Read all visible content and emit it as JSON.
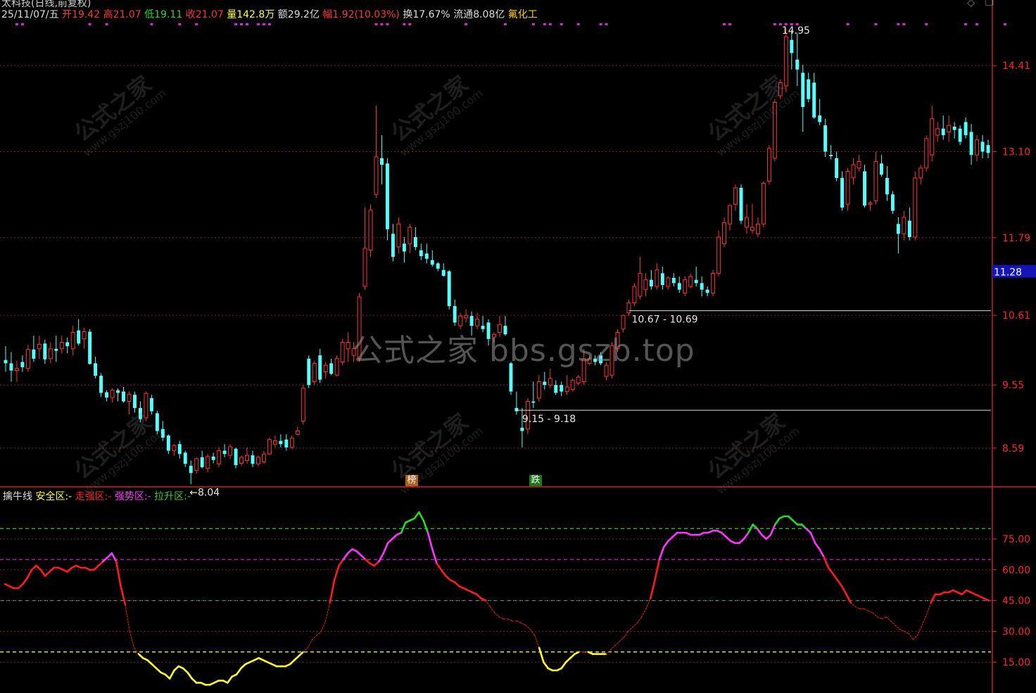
{
  "header": {
    "title": "太科技(日线,前复权)",
    "date": "25/11/07/五",
    "open_label": "开",
    "open": "19.42",
    "high_label": "高",
    "high": "21.07",
    "low_label": "低",
    "low": "19.11",
    "close_label": "收",
    "close": "21.07",
    "volume_label": "量",
    "volume": "142.8万",
    "amount_label": "额",
    "amount": "29.2亿",
    "change_label": "幅",
    "change": "1.92(10.03%)",
    "turnover_label": "换",
    "turnover": "17.67%",
    "float_label": "流通",
    "float": "8.08亿",
    "sector": "氟化工"
  },
  "indicator": {
    "name": "擒牛线",
    "items": [
      {
        "label": "安全区:",
        "value": "-",
        "color": "#ffff33"
      },
      {
        "label": "走强区:",
        "value": "-",
        "color": "#ff2222"
      },
      {
        "label": "强势区:",
        "value": "-",
        "color": "#ff33ff"
      },
      {
        "label": "拉升区:",
        "value": "-",
        "color": "#33cc33"
      }
    ]
  },
  "tags": [
    {
      "text": "榜",
      "bg": "#b06018"
    },
    {
      "text": "跌",
      "bg": "#1a7a1a"
    }
  ],
  "watermark": {
    "main": "公式之家 bbs.gszb.top",
    "brand": "公式之家",
    "url": "www.gszj100.com"
  },
  "colors": {
    "up": "#ff3333",
    "down": "#54ffff",
    "grid": "#8a1a1a",
    "axis": "#ff2222"
  },
  "chart_data": [
    {
      "type": "candlestick",
      "title": "太科技(日线,前复权)",
      "ylim": [
        8.0,
        15.3
      ],
      "y_ticks": [
        "14.41",
        "13.10",
        "11.79",
        "10.61",
        "9.55",
        "8.59"
      ],
      "current_price": "11.28",
      "annotations": [
        "←8.04",
        "14.95",
        "10.67 - 10.69",
        "9.15 - 9.18"
      ],
      "ohlc": [
        [
          9.93,
          10.14,
          9.75,
          9.88
        ],
        [
          9.88,
          10.05,
          9.6,
          9.77
        ],
        [
          9.77,
          9.92,
          9.6,
          9.8
        ],
        [
          9.9,
          10.0,
          9.75,
          9.82
        ],
        [
          9.8,
          10.16,
          9.75,
          10.09
        ],
        [
          10.09,
          10.3,
          9.9,
          9.95
        ],
        [
          10.1,
          10.3,
          9.95,
          10.17
        ],
        [
          10.18,
          10.24,
          9.87,
          9.94
        ],
        [
          9.95,
          10.2,
          9.88,
          10.1
        ],
        [
          10.1,
          10.3,
          9.9,
          10.07
        ],
        [
          10.1,
          10.3,
          10.03,
          10.2
        ],
        [
          10.2,
          10.27,
          10.03,
          10.14
        ],
        [
          10.1,
          10.45,
          10.0,
          10.35
        ],
        [
          10.38,
          10.55,
          10.15,
          10.18
        ],
        [
          10.25,
          10.42,
          10.1,
          10.36
        ],
        [
          10.36,
          10.4,
          9.86,
          9.87
        ],
        [
          9.88,
          9.98,
          9.65,
          9.69
        ],
        [
          9.69,
          9.73,
          9.37,
          9.43
        ],
        [
          9.44,
          9.47,
          9.3,
          9.36
        ],
        [
          9.36,
          9.5,
          9.28,
          9.47
        ],
        [
          9.47,
          9.5,
          9.3,
          9.43
        ],
        [
          9.45,
          9.52,
          9.28,
          9.3
        ],
        [
          9.3,
          9.45,
          9.1,
          9.41
        ],
        [
          9.4,
          9.45,
          9.13,
          9.2
        ],
        [
          9.2,
          9.3,
          8.98,
          9.03
        ],
        [
          9.05,
          9.45,
          9.0,
          9.42
        ],
        [
          9.35,
          9.4,
          9.1,
          9.15
        ],
        [
          9.12,
          9.16,
          8.8,
          8.85
        ],
        [
          8.88,
          9.0,
          8.7,
          8.75
        ],
        [
          8.78,
          8.8,
          8.5,
          8.55
        ],
        [
          8.55,
          8.65,
          8.47,
          8.63
        ],
        [
          8.65,
          8.7,
          8.43,
          8.5
        ],
        [
          8.52,
          8.55,
          8.3,
          8.35
        ],
        [
          8.32,
          8.4,
          8.04,
          8.21
        ],
        [
          8.25,
          8.45,
          8.2,
          8.43
        ],
        [
          8.45,
          8.55,
          8.28,
          8.3
        ],
        [
          8.28,
          8.5,
          8.22,
          8.46
        ],
        [
          8.46,
          8.52,
          8.36,
          8.41
        ],
        [
          8.35,
          8.6,
          8.3,
          8.55
        ],
        [
          8.55,
          8.65,
          8.45,
          8.5
        ],
        [
          8.48,
          8.65,
          8.42,
          8.61
        ],
        [
          8.58,
          8.6,
          8.28,
          8.33
        ],
        [
          8.36,
          8.48,
          8.32,
          8.45
        ],
        [
          8.4,
          8.6,
          8.35,
          8.48
        ],
        [
          8.48,
          8.55,
          8.3,
          8.35
        ],
        [
          8.35,
          8.48,
          8.31,
          8.45
        ],
        [
          8.38,
          8.55,
          8.35,
          8.5
        ],
        [
          8.5,
          8.75,
          8.48,
          8.72
        ],
        [
          8.65,
          8.78,
          8.6,
          8.7
        ],
        [
          8.7,
          8.8,
          8.6,
          8.65
        ],
        [
          8.72,
          8.8,
          8.55,
          8.6
        ],
        [
          8.6,
          8.78,
          8.58,
          8.74
        ],
        [
          8.8,
          8.92,
          8.78,
          8.85
        ],
        [
          9.0,
          9.55,
          8.95,
          9.5
        ],
        [
          9.95,
          10.0,
          9.5,
          9.55
        ],
        [
          9.6,
          9.92,
          9.55,
          9.88
        ],
        [
          10.0,
          10.1,
          9.58,
          9.63
        ],
        [
          9.75,
          9.9,
          9.65,
          9.85
        ],
        [
          9.88,
          9.95,
          9.7,
          9.72
        ],
        [
          9.7,
          10.0,
          9.68,
          9.95
        ],
        [
          9.9,
          10.25,
          9.85,
          10.2
        ],
        [
          10.1,
          10.35,
          9.9,
          10.2
        ],
        [
          10.0,
          10.2,
          9.9,
          10.1
        ],
        [
          9.95,
          10.95,
          9.9,
          10.89
        ],
        [
          11.05,
          12.25,
          11.0,
          11.63
        ],
        [
          11.6,
          12.3,
          11.5,
          12.21
        ],
        [
          12.45,
          13.8,
          12.4,
          13.02
        ],
        [
          13.0,
          13.35,
          12.6,
          12.9
        ],
        [
          12.92,
          13.0,
          11.75,
          11.92
        ],
        [
          11.85,
          12.0,
          11.43,
          11.5
        ],
        [
          11.65,
          12.1,
          11.55,
          12.0
        ],
        [
          11.7,
          11.8,
          11.41,
          11.58
        ],
        [
          11.7,
          12.0,
          11.55,
          11.95
        ],
        [
          11.8,
          11.95,
          11.6,
          11.65
        ],
        [
          11.6,
          11.7,
          11.45,
          11.51
        ],
        [
          11.55,
          11.7,
          11.4,
          11.47
        ],
        [
          11.45,
          11.6,
          11.35,
          11.38
        ],
        [
          11.4,
          11.42,
          11.28,
          11.32
        ],
        [
          11.3,
          11.4,
          11.2,
          11.21
        ],
        [
          11.28,
          11.3,
          10.7,
          10.75
        ],
        [
          10.75,
          10.85,
          10.45,
          10.5
        ],
        [
          10.45,
          10.65,
          10.4,
          10.6
        ],
        [
          10.57,
          10.7,
          10.5,
          10.61
        ],
        [
          10.6,
          10.67,
          10.3,
          10.45
        ],
        [
          10.45,
          10.65,
          10.4,
          10.55
        ],
        [
          10.45,
          10.6,
          10.35,
          10.4
        ],
        [
          10.5,
          10.55,
          10.15,
          10.25
        ],
        [
          10.28,
          10.35,
          10.2,
          10.32
        ],
        [
          10.35,
          10.6,
          10.28,
          10.47
        ],
        [
          10.45,
          10.6,
          10.3,
          10.32
        ],
        [
          9.88,
          9.9,
          9.4,
          9.45
        ],
        [
          9.2,
          9.45,
          9.1,
          9.15
        ],
        [
          8.9,
          9.2,
          8.6,
          8.85
        ],
        [
          8.88,
          9.35,
          8.8,
          9.3
        ],
        [
          9.3,
          9.6,
          9.2,
          9.28
        ],
        [
          9.35,
          9.7,
          9.3,
          9.6
        ],
        [
          9.6,
          9.75,
          9.48,
          9.55
        ],
        [
          9.55,
          9.8,
          9.5,
          9.65
        ],
        [
          9.55,
          9.62,
          9.4,
          9.43
        ],
        [
          9.55,
          9.6,
          9.38,
          9.45
        ],
        [
          9.45,
          9.7,
          9.4,
          9.52
        ],
        [
          9.48,
          9.65,
          9.45,
          9.62
        ],
        [
          9.58,
          9.7,
          9.55,
          9.67
        ],
        [
          9.6,
          10.1,
          9.55,
          9.95
        ],
        [
          9.88,
          10.0,
          9.85,
          9.95
        ],
        [
          9.95,
          10.0,
          9.85,
          9.9
        ],
        [
          10.0,
          10.05,
          9.85,
          9.88
        ],
        [
          9.68,
          9.9,
          9.62,
          9.85
        ],
        [
          9.7,
          10.2,
          9.65,
          10.15
        ],
        [
          10.1,
          10.4,
          10.05,
          10.35
        ],
        [
          10.4,
          10.62,
          10.35,
          10.61
        ],
        [
          10.65,
          10.85,
          10.6,
          10.8
        ],
        [
          10.8,
          11.1,
          10.75,
          11.05
        ],
        [
          10.9,
          11.5,
          10.85,
          11.25
        ],
        [
          11.0,
          11.25,
          10.9,
          11.15
        ],
        [
          11.15,
          11.3,
          11.0,
          11.05
        ],
        [
          11.05,
          11.4,
          11.0,
          11.3
        ],
        [
          11.25,
          11.35,
          11.0,
          11.07
        ],
        [
          11.05,
          11.2,
          11.0,
          11.18
        ],
        [
          11.18,
          11.25,
          11.05,
          11.1
        ],
        [
          11.1,
          11.2,
          10.95,
          11.0
        ],
        [
          10.95,
          11.2,
          10.9,
          11.15
        ],
        [
          11.05,
          11.25,
          11.02,
          11.2
        ],
        [
          11.15,
          11.35,
          11.05,
          11.1
        ],
        [
          11.1,
          11.2,
          10.9,
          11.0
        ],
        [
          11.0,
          11.05,
          10.9,
          10.95
        ],
        [
          10.95,
          11.3,
          10.9,
          11.25
        ],
        [
          11.25,
          11.9,
          11.2,
          11.8
        ],
        [
          11.7,
          12.1,
          11.65,
          12.02
        ],
        [
          12.0,
          12.3,
          11.9,
          12.28
        ],
        [
          12.3,
          12.6,
          12.2,
          12.55
        ],
        [
          12.55,
          12.6,
          12.0,
          12.05
        ],
        [
          11.95,
          12.3,
          11.85,
          12.1
        ],
        [
          11.9,
          12.3,
          11.85,
          11.95
        ],
        [
          11.85,
          12.1,
          11.8,
          12.0
        ],
        [
          12.0,
          12.65,
          11.95,
          12.62
        ],
        [
          12.65,
          13.2,
          12.6,
          13.15
        ],
        [
          13.0,
          13.9,
          12.95,
          13.85
        ],
        [
          13.95,
          14.2,
          13.9,
          14.15
        ],
        [
          14.1,
          14.98,
          14.0,
          14.85
        ],
        [
          14.8,
          14.95,
          14.35,
          14.6
        ],
        [
          14.5,
          14.9,
          14.1,
          14.35
        ],
        [
          14.3,
          14.42,
          13.4,
          13.78
        ],
        [
          14.2,
          14.3,
          13.85,
          13.9
        ],
        [
          14.15,
          14.3,
          13.6,
          13.62
        ],
        [
          13.65,
          13.9,
          13.5,
          13.55
        ],
        [
          13.5,
          13.6,
          13.02,
          13.1
        ],
        [
          13.05,
          13.2,
          12.98,
          13.03
        ],
        [
          13.0,
          13.1,
          12.65,
          12.7
        ],
        [
          12.7,
          12.8,
          12.2,
          12.25
        ],
        [
          12.3,
          12.85,
          12.2,
          12.8
        ],
        [
          12.7,
          13.0,
          12.6,
          12.9
        ],
        [
          12.85,
          13.05,
          12.8,
          12.95
        ],
        [
          12.8,
          12.9,
          12.25,
          12.28
        ],
        [
          12.3,
          12.35,
          12.2,
          12.32
        ],
        [
          12.35,
          13.1,
          12.3,
          12.95
        ],
        [
          12.92,
          13.05,
          12.72,
          12.75
        ],
        [
          12.7,
          12.88,
          12.35,
          12.45
        ],
        [
          12.45,
          12.5,
          12.15,
          12.2
        ],
        [
          12.0,
          12.1,
          11.55,
          11.85
        ],
        [
          11.85,
          12.2,
          11.75,
          12.1
        ],
        [
          12.05,
          12.25,
          11.75,
          11.8
        ],
        [
          11.8,
          12.8,
          11.75,
          12.7
        ],
        [
          12.7,
          12.9,
          12.6,
          12.85
        ],
        [
          12.85,
          13.35,
          12.8,
          13.3
        ],
        [
          13.05,
          13.8,
          12.95,
          13.6
        ],
        [
          13.35,
          13.55,
          13.25,
          13.45
        ],
        [
          13.45,
          13.65,
          13.28,
          13.35
        ],
        [
          13.4,
          13.65,
          13.25,
          13.5
        ],
        [
          13.48,
          13.55,
          13.3,
          13.43
        ],
        [
          13.45,
          13.5,
          13.2,
          13.25
        ],
        [
          13.55,
          13.62,
          13.3,
          13.35
        ],
        [
          13.4,
          13.52,
          12.9,
          13.05
        ],
        [
          13.05,
          13.35,
          12.95,
          13.28
        ],
        [
          13.25,
          13.35,
          13.0,
          13.1
        ],
        [
          13.2,
          13.28,
          13.0,
          13.08
        ]
      ]
    },
    {
      "type": "line",
      "title": "擒牛线",
      "ylim": [
        0,
        100
      ],
      "y_ticks": [
        "75.00",
        "60.00",
        "45.00",
        "30.00",
        "15.00"
      ],
      "levels": [
        80,
        65,
        45,
        20
      ],
      "values": [
        53,
        52,
        51,
        51,
        53,
        56,
        60,
        62,
        60,
        57,
        59,
        61,
        61,
        60,
        59,
        61,
        62,
        61,
        61,
        60,
        60,
        62,
        64,
        66,
        68,
        64,
        52,
        43,
        30,
        22,
        19,
        17,
        16,
        14,
        12,
        10,
        9,
        7,
        11,
        13,
        12,
        10,
        7,
        5,
        5,
        4,
        4,
        5,
        6,
        6,
        5,
        8,
        9,
        12,
        14,
        15,
        16,
        17,
        16,
        15,
        14,
        13,
        13,
        13,
        14,
        16,
        18,
        20,
        22,
        26,
        28,
        30,
        35,
        44,
        55,
        62,
        65,
        68,
        70,
        69,
        67,
        65,
        63,
        62,
        64,
        68,
        73,
        75,
        77,
        78,
        83,
        84,
        85,
        88,
        84,
        78,
        70,
        63,
        60,
        57,
        55,
        54,
        52,
        51,
        50,
        49,
        48,
        46,
        45,
        42,
        39,
        37,
        36,
        36,
        35,
        35,
        34,
        33,
        31,
        28,
        22,
        15,
        12,
        11,
        11,
        12,
        15,
        17,
        19,
        20,
        20,
        20,
        19,
        19,
        19,
        19,
        21,
        23,
        25,
        27,
        30,
        32,
        34,
        37,
        41,
        46,
        55,
        65,
        71,
        74,
        76,
        78,
        78,
        78,
        77,
        77,
        77,
        78,
        78,
        79,
        79,
        78,
        76,
        74,
        73,
        73,
        75,
        78,
        82,
        80,
        77,
        75,
        77,
        82,
        85,
        86,
        86,
        84,
        82,
        82,
        80,
        78,
        73,
        70,
        66,
        61,
        58,
        55,
        52,
        48,
        44,
        42,
        41,
        41,
        40,
        39,
        37,
        36,
        37,
        35,
        33,
        31,
        30,
        29,
        26,
        28,
        33,
        38,
        44,
        48,
        48,
        49,
        49,
        50,
        49,
        48,
        50,
        49,
        48,
        47,
        46,
        45
      ]
    }
  ]
}
